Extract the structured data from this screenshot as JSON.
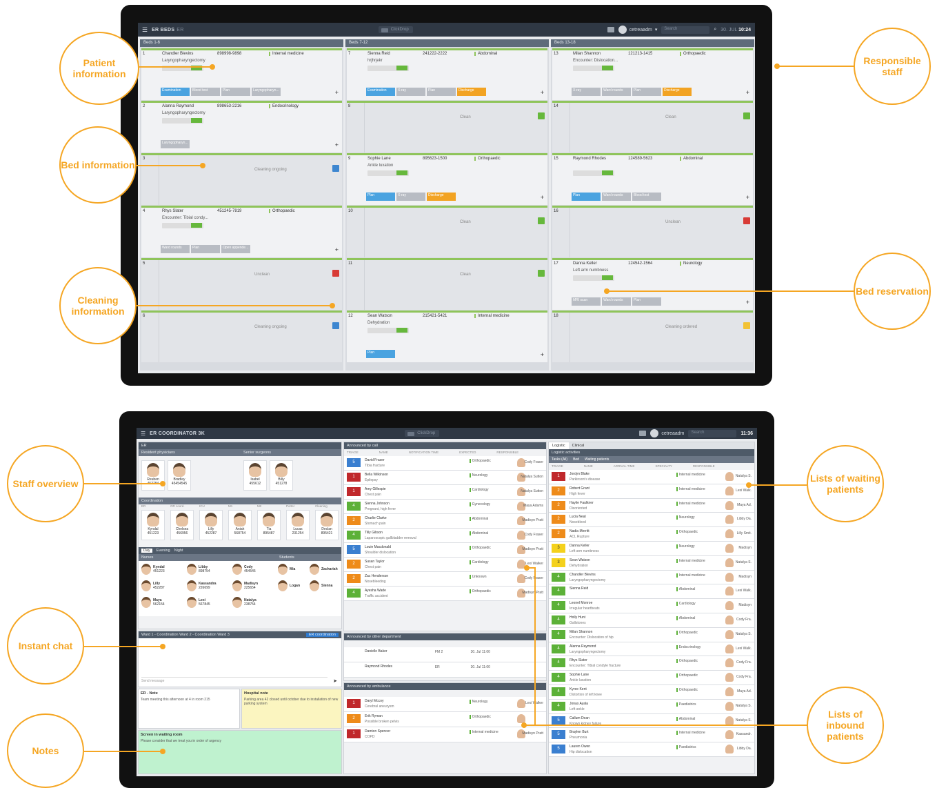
{
  "top_screen": {
    "app_title": "ER BEDS",
    "app_sub": "ER",
    "clickdrop": "ClickDrop",
    "user": "cetreaadm",
    "search_placeholder": "Search",
    "date": "30. JUL",
    "time": "10:24",
    "columns": [
      "Beds 1-6",
      "Beds 7-12",
      "Beds 13-18"
    ],
    "beds": [
      {
        "num": "1",
        "name": "Chandler Blevins",
        "id": "898998-9898",
        "spec": "Internal medicine",
        "diag": "Laryngopharyngectomy",
        "tasks": [
          "Examination",
          "Blood test",
          "Plan",
          "Laryngopharyn..."
        ]
      },
      {
        "num": "2",
        "name": "Alanna Raymond",
        "id": "898653-2216",
        "spec": "Endocrinology",
        "diag": "Laryngopharyngectomy",
        "tasks": [
          "Laryngopharyn..."
        ]
      },
      {
        "num": "3",
        "status": "Cleaning ongoing",
        "state": "blue"
      },
      {
        "num": "4",
        "name": "Rhys Slater",
        "id": "451245-7819",
        "spec": "Orthopaedic",
        "diag": "Encounter: Tibial condy...",
        "tasks": [
          "Ward rounds",
          "Plan",
          "Open appende..."
        ]
      },
      {
        "num": "5",
        "status": "Unclean",
        "state": "bad"
      },
      {
        "num": "6",
        "status": "Cleaning ongoing",
        "state": "blue"
      },
      {
        "num": "7",
        "name": "Sienna Reid",
        "id": "241222-2222",
        "spec": "Abdominal",
        "diag": "hrjhrjekr",
        "tasks": [
          "Examination",
          "X-ray",
          "Plan",
          "Discharge"
        ]
      },
      {
        "num": "8",
        "status": "Clean",
        "state": "ok"
      },
      {
        "num": "9",
        "name": "Sophie Lane",
        "id": "895623-1500",
        "spec": "Orthopaedic",
        "diag": "Ankle luxation",
        "tasks": [
          "Plan",
          "X-ray",
          "Discharge"
        ]
      },
      {
        "num": "10",
        "status": "Clean",
        "state": "ok"
      },
      {
        "num": "11",
        "status": "Clean",
        "state": "ok"
      },
      {
        "num": "12",
        "name": "Sean Watson",
        "id": "215421-5421",
        "spec": "Internal medicine",
        "diag": "Dehydration",
        "tasks": [
          "Plan"
        ]
      },
      {
        "num": "13",
        "name": "Milan Shannon",
        "id": "121213-1415",
        "spec": "Orthopaedic",
        "diag": "Encounter: Dislocation...",
        "tasks": [
          "X-ray",
          "Ward rounds",
          "Plan",
          "Discharge"
        ]
      },
      {
        "num": "14",
        "status": "Clean",
        "state": "ok"
      },
      {
        "num": "15",
        "name": "Raymond Rhodes",
        "id": "124589-5623",
        "spec": "Abdominal",
        "diag": "",
        "tasks": [
          "Plan",
          "Ward rounds",
          "Blood test"
        ]
      },
      {
        "num": "16",
        "status": "Unclean",
        "state": "bad"
      },
      {
        "num": "17",
        "name": "Danna Keller",
        "id": "124542-1564",
        "spec": "Neurology",
        "diag": "Left arm numbness",
        "tasks": [
          "MRI scan",
          "Ward rounds",
          "Plan"
        ]
      },
      {
        "num": "18",
        "status": "Cleaning ordered",
        "state": "yel"
      }
    ]
  },
  "bottom_screen": {
    "app_title": "ER COORDINATOR 3K",
    "clickdrop": "ClickDrop",
    "user": "cetreaadm",
    "search_placeholder": "Search",
    "time": "11:36",
    "staff": {
      "header": "ER",
      "groups": [
        "Resident physicians",
        "Senior surgeons"
      ],
      "residents": [
        {
          "name": "Reuben",
          "id": "452784"
        },
        {
          "name": "Bradley",
          "id": "45454545"
        }
      ],
      "seniors": [
        {
          "name": "Isabel",
          "id": "455612"
        },
        {
          "name": "Billy",
          "id": "451278"
        }
      ],
      "coordination_label": "Coordination",
      "coordination_roles": [
        "ER",
        "OR coord.",
        "ICU",
        "M1",
        "M2",
        "Porter",
        "Cleaning"
      ],
      "coordination": [
        {
          "name": "Kyndal",
          "id": "451223"
        },
        {
          "name": "Chelsea",
          "id": "456956"
        },
        {
          "name": "Lilly",
          "id": "452287"
        },
        {
          "name": "Aniah",
          "id": "568754"
        },
        {
          "name": "Tia",
          "id": "895487"
        },
        {
          "name": "Lucas",
          "id": "231254"
        },
        {
          "name": "Declan",
          "id": "895421"
        }
      ],
      "shift_tabs": [
        "Day",
        "Evening",
        "Night"
      ],
      "nurses_label": "Nurses",
      "students_label": "Students",
      "nurses": [
        {
          "name": "Kyndal",
          "id": "451223"
        },
        {
          "name": "Libby",
          "id": "898754"
        },
        {
          "name": "Cody",
          "id": "454545"
        },
        {
          "name": "Lilly",
          "id": "452287"
        },
        {
          "name": "Kassandra",
          "id": "226699"
        },
        {
          "name": "Madisyn",
          "id": "225654"
        },
        {
          "name": "Maya",
          "id": "562154"
        },
        {
          "name": "Lexi",
          "id": "567845"
        },
        {
          "name": "Natalya",
          "id": "238754"
        }
      ],
      "students": [
        {
          "name": "Mia"
        },
        {
          "name": "Zachariah"
        },
        {
          "name": "Logan"
        },
        {
          "name": "Sienna"
        }
      ]
    },
    "chat": {
      "tabs": "Ward 1 - Coordination  Ward 2 - Coordination  Ward 3",
      "label": "ER coordination",
      "placeholder": "Send message"
    },
    "notes": [
      {
        "title": "ER - Note",
        "text": "Team meeting this afternoon at 4 in room 215"
      },
      {
        "title": "Hospital note",
        "text": "Parking area 42 closed until october due to installation of new parking system"
      },
      {
        "title": "Screen in waiting room",
        "text": "Please consider that we treat you in order of urgency"
      }
    ],
    "announced_call": {
      "title": "Announced by call",
      "headers": [
        "TRIAGE",
        "NAME",
        "NOTIFICATION TIME",
        "EXPECTED",
        "RESPONSIBLE"
      ],
      "rows": [
        {
          "lvl": "5",
          "c": "bl",
          "name": "David Fraser",
          "diag": "Tibia fracture",
          "spec": "Orthopaedic",
          "resp": "Cody Fraser"
        },
        {
          "lvl": "1",
          "c": "r",
          "name": "Bella Wilkinson",
          "diag": "Epilepsy",
          "spec": "Neurology",
          "resp": "Natalya Sutton"
        },
        {
          "lvl": "1",
          "c": "r",
          "name": "Amy Gillespie",
          "diag": "Chest pain",
          "spec": "Cardiology",
          "resp": "Natalya Sutton"
        },
        {
          "lvl": "4",
          "c": "g",
          "name": "Sienna Johnson",
          "diag": "Pregnant, high fever",
          "spec": "Gynecology",
          "resp": "Maya Adams"
        },
        {
          "lvl": "2",
          "c": "o",
          "name": "Charlie Clarke",
          "diag": "Stomach pain",
          "spec": "Abdominal",
          "resp": "Madisyn Pratt"
        },
        {
          "lvl": "4",
          "c": "g",
          "name": "Tilly Gibson",
          "diag": "Laparoscopic gallbladder removal",
          "spec": "Abdominal",
          "resp": "Cody Fraser"
        },
        {
          "lvl": "5",
          "c": "bl",
          "name": "Louie Macdonald",
          "diag": "Shoulder dislocation",
          "spec": "Orthopaedic",
          "resp": "Madisyn Pratt"
        },
        {
          "lvl": "2",
          "c": "o",
          "name": "Susan Taylor",
          "diag": "Chest pain",
          "spec": "Cardiology",
          "resp": "Lexi Walker"
        },
        {
          "lvl": "2",
          "c": "o",
          "name": "Zac Henderson",
          "diag": "Nosebleeding",
          "spec": "Unknown",
          "resp": "Cody Fraser"
        },
        {
          "lvl": "4",
          "c": "g",
          "name": "Ayesha Wade",
          "diag": "Traffic accident",
          "spec": "Orthopaedic",
          "resp": "Madisyn Pratt"
        }
      ]
    },
    "announced_dept": {
      "title": "Announced by other department",
      "rows": [
        {
          "name": "Danielle Baker",
          "from": "FM 2",
          "time": "30. Jul 11:00"
        },
        {
          "name": "Raymond Rhodes",
          "from": "ER",
          "time": "30. Jul 11:00"
        }
      ]
    },
    "announced_amb": {
      "title": "Announced by ambulance",
      "rows": [
        {
          "lvl": "1",
          "c": "r",
          "name": "Daryl Mccoy",
          "diag": "Cerebral aneurysm",
          "spec": "Neurology",
          "resp": "Lexi Walker"
        },
        {
          "lvl": "2",
          "c": "o",
          "name": "Erik Ryman",
          "diag": "Possible broken pelvis",
          "spec": "Orthopaedic",
          "resp": ""
        },
        {
          "lvl": "1",
          "c": "r",
          "name": "Damion Spencer",
          "diag": "COPD",
          "spec": "Internal medicine",
          "resp": "Madisyn Pratt"
        }
      ]
    },
    "logistic": {
      "tabs": [
        "Logistic",
        "Clinical"
      ],
      "title": "Logistic activities",
      "subtabs": [
        "Tasks (All)",
        "Bed",
        "Waiting patients"
      ],
      "headers": [
        "TRIAGE",
        "NAME",
        "ARRIVAL TIME",
        "SPECIALTY",
        "RESPONSIBLE"
      ],
      "rows": [
        {
          "lvl": "1",
          "c": "r",
          "name": "Jordyn Blake",
          "diag": "Parkinson's disease",
          "spec": "Internal medicine",
          "resp": "Natalya S."
        },
        {
          "lvl": "2",
          "c": "o",
          "name": "Robert Grant",
          "diag": "High fever",
          "spec": "Internal medicine",
          "resp": "Lexi Walk."
        },
        {
          "lvl": "2",
          "c": "o",
          "name": "Haylie Faulkner",
          "diag": "Disoriented",
          "spec": "Internal medicine",
          "resp": "Maya Ad."
        },
        {
          "lvl": "2",
          "c": "o",
          "name": "Lucia Neal",
          "diag": "Nosebleed",
          "spec": "Neurology",
          "resp": "Libby Da."
        },
        {
          "lvl": "2",
          "c": "o",
          "name": "Nadia Merritt",
          "diag": "ACL Rupture",
          "spec": "Orthopaedic",
          "resp": "Lilly Smit."
        },
        {
          "lvl": "3",
          "c": "y",
          "name": "Danna Keller",
          "diag": "Left arm numbness",
          "spec": "Neurology",
          "resp": "Madisyn"
        },
        {
          "lvl": "3",
          "c": "y",
          "name": "Sean Watson",
          "diag": "Dehydration",
          "spec": "Internal medicine",
          "resp": "Natalya S."
        },
        {
          "lvl": "4",
          "c": "g",
          "name": "Chandler Blevins",
          "diag": "Laryngopharyngectomy",
          "spec": "Internal medicine",
          "resp": "Madisyn"
        },
        {
          "lvl": "4",
          "c": "g",
          "name": "Sienna Reid",
          "diag": "",
          "spec": "Abdominal",
          "resp": "Lexi Walk."
        },
        {
          "lvl": "4",
          "c": "g",
          "name": "Leonel Monroe",
          "diag": "Irregular heartbeats",
          "spec": "Cardiology",
          "resp": "Madisyn"
        },
        {
          "lvl": "4",
          "c": "g",
          "name": "Holly Hunt",
          "diag": "Gallstones",
          "spec": "Abdominal",
          "resp": "Cody Fra."
        },
        {
          "lvl": "4",
          "c": "g",
          "name": "Milan Shannon",
          "diag": "Encounter: Dislocation of hip",
          "spec": "Orthopaedic",
          "resp": "Natalya S."
        },
        {
          "lvl": "4",
          "c": "g",
          "name": "Alanna Raymond",
          "diag": "Laryngopharyngectomy",
          "spec": "Endocrinology",
          "resp": "Lexi Walk."
        },
        {
          "lvl": "4",
          "c": "g",
          "name": "Rhys Slater",
          "diag": "Encounter: Tibial condyle fracture",
          "spec": "Orthopaedic",
          "resp": "Cody Fra."
        },
        {
          "lvl": "4",
          "c": "g",
          "name": "Sophie Lane",
          "diag": "Ankle luxation",
          "spec": "Orthopaedic",
          "resp": "Cody Fra."
        },
        {
          "lvl": "4",
          "c": "g",
          "name": "Kyree Kent",
          "diag": "Distortion of left knee",
          "spec": "Orthopaedic",
          "resp": "Maya Ad."
        },
        {
          "lvl": "4",
          "c": "g",
          "name": "Jonas Ayala",
          "diag": "Left ankle",
          "spec": "Paediatrics",
          "resp": "Natalya S."
        },
        {
          "lvl": "5",
          "c": "bl",
          "name": "Callum Dean",
          "diag": "Known kidney failure",
          "spec": "Abdominal",
          "resp": "Natalya S."
        },
        {
          "lvl": "5",
          "c": "bl",
          "name": "Braylen Burt",
          "diag": "Pneumonia",
          "spec": "Internal medicine",
          "resp": "Kassandr."
        },
        {
          "lvl": "5",
          "c": "bl",
          "name": "Lauren Owen",
          "diag": "Hip dislocation",
          "spec": "Paediatrics",
          "resp": "Libby Da."
        }
      ]
    }
  },
  "callouts": {
    "patient_info": "Patient information",
    "bed_info": "Bed information",
    "cleaning_info": "Cleaning information",
    "responsible_staff": "Responsible staff",
    "bed_reservation": "Bed reservation",
    "staff_overview": "Staff overview",
    "instant_chat": "Instant chat",
    "notes": "Notes",
    "waiting_lists": "Lists of waiting patients",
    "inbound_lists": "Lists of inbound patients"
  }
}
